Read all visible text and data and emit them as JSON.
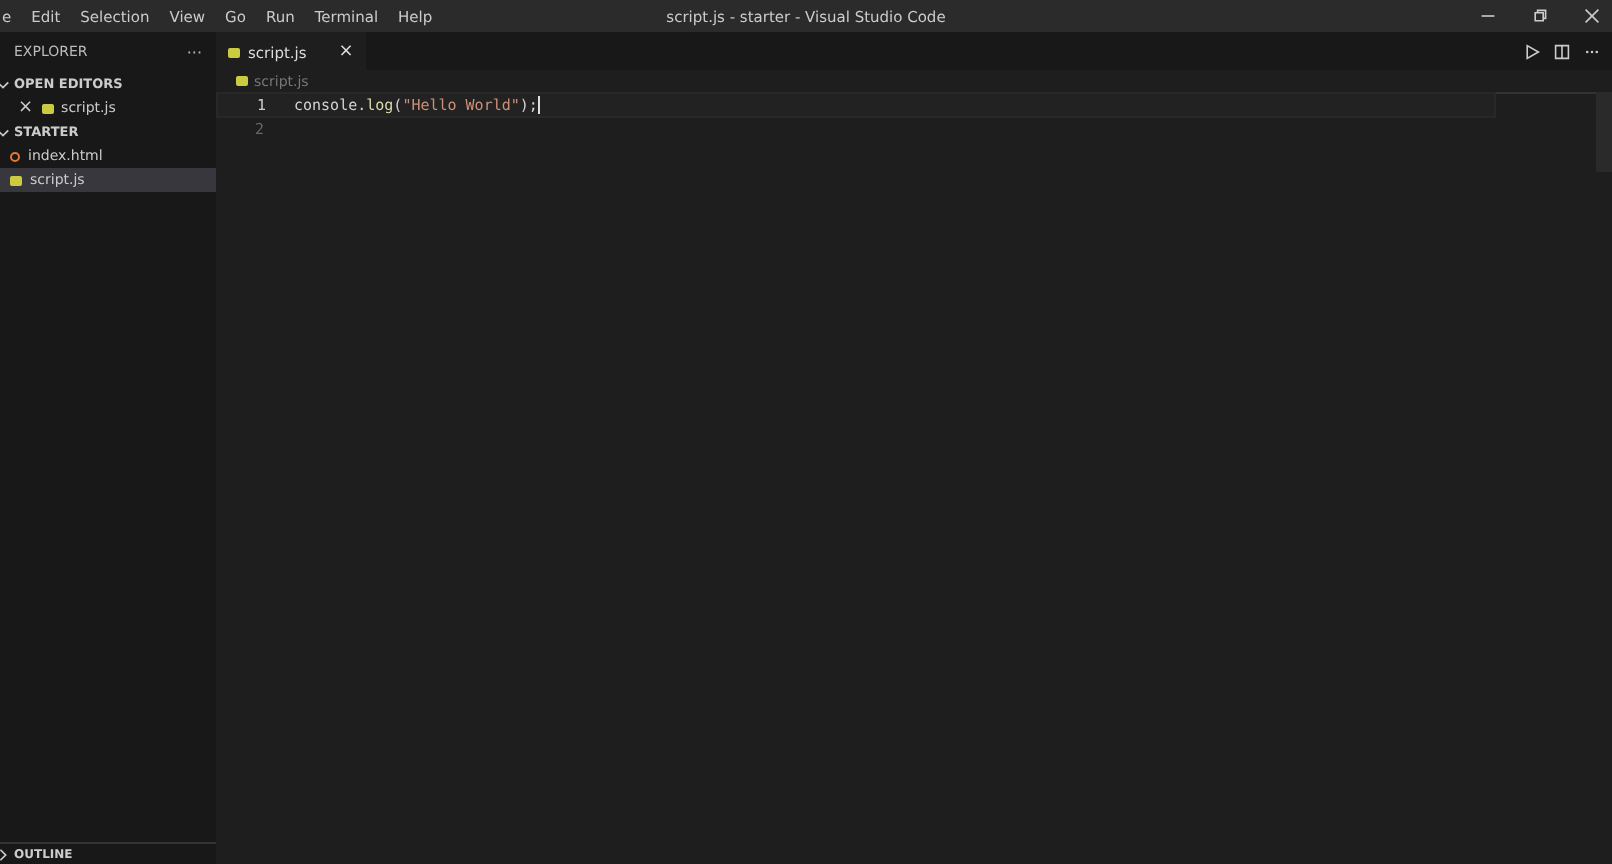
{
  "menu": [
    "e",
    "Edit",
    "Selection",
    "View",
    "Go",
    "Run",
    "Terminal",
    "Help"
  ],
  "window": {
    "title": "script.js - starter - Visual Studio Code"
  },
  "sidebar": {
    "title": "EXPLORER",
    "more": "···",
    "sections": [
      {
        "label": "OPEN EDITORS",
        "expanded": true,
        "items": [
          {
            "name": "script.js",
            "kind": "js",
            "close": "×",
            "selected": false
          }
        ]
      },
      {
        "label": "STARTER",
        "expanded": true,
        "items": [
          {
            "name": "index.html",
            "kind": "html",
            "selected": false
          },
          {
            "name": "script.js",
            "kind": "js",
            "selected": true
          }
        ]
      }
    ],
    "bottom_section": {
      "label": "OUTLINE",
      "expanded": false
    }
  },
  "tabs": [
    {
      "label": "script.js",
      "kind": "js",
      "close": "×",
      "selected": true
    }
  ],
  "breadcrumb": {
    "label": "script.js",
    "kind": "js"
  },
  "editor": {
    "lines": [
      {
        "number": "1",
        "tokens": [
          {
            "text": "console",
            "kind": "ident"
          },
          {
            "text": ".",
            "kind": "punct"
          },
          {
            "text": "log",
            "kind": "func"
          },
          {
            "text": "(",
            "kind": "punct"
          },
          {
            "text": "\"Hello World\"",
            "kind": "string"
          },
          {
            "text": ");",
            "kind": "punct"
          }
        ],
        "current": true
      },
      {
        "number": "2",
        "current": false
      }
    ]
  }
}
